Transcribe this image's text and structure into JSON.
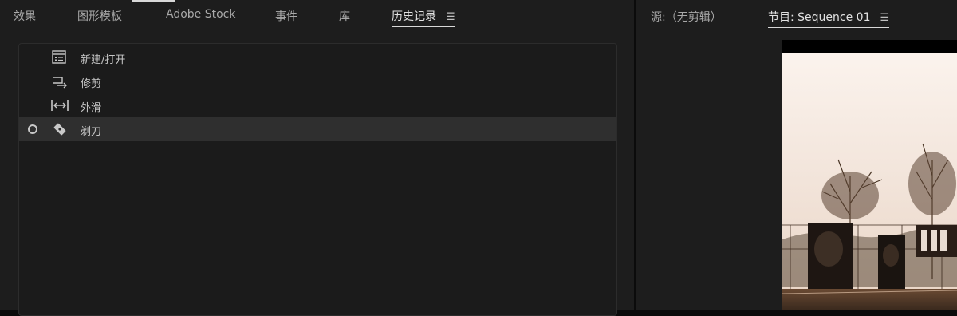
{
  "left_tabs": {
    "effects": "效果",
    "graphics_templates": "图形模板",
    "adobe_stock": "Adobe Stock",
    "events": "事件",
    "libraries": "库",
    "history": "历史记录"
  },
  "history": {
    "items": [
      {
        "label": "新建/打开",
        "icon": "new-open-icon"
      },
      {
        "label": "修剪",
        "icon": "trim-icon"
      },
      {
        "label": "外滑",
        "icon": "slip-icon"
      },
      {
        "label": "剃刀",
        "icon": "razor-icon"
      }
    ],
    "selected_index": 3
  },
  "right_tabs": {
    "source": "源:（无剪辑）",
    "program": "节目: Sequence 01"
  },
  "colors": {
    "panel_bg": "#1d1d1d",
    "selected_row": "#2f2f2f",
    "active_underline": "#d8d8d8"
  }
}
